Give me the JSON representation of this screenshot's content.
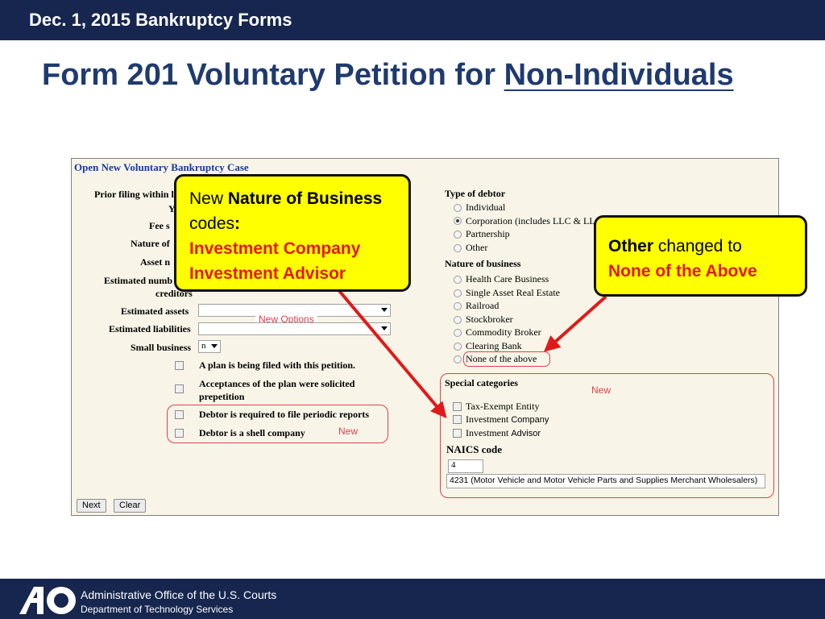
{
  "header": {
    "title": "Dec. 1, 2015 Bankruptcy Forms"
  },
  "slide": {
    "title_main": "Form 201 Voluntary Petition for ",
    "title_underlined": "Non-Individuals"
  },
  "screen": {
    "title": "Open New Voluntary Bankruptcy Case",
    "left": {
      "prior_filing_label": "Prior filing within l",
      "y_label": "Y",
      "fee_label": "Fee s",
      "nature_label": "Nature of",
      "asset_label": "Asset n",
      "estimated_number_label": "Estimated numb",
      "creditors_label": "creditors",
      "estimated_assets_label": "Estimated assets",
      "estimated_liabilities_label": "Estimated liabilities",
      "small_business_label": "Small business",
      "small_business_value": "n",
      "new_options_label": "New Options",
      "checkboxes": [
        "A plan is being filed with this petition.",
        "Acceptances of the plan were solicited",
        "prepetition",
        "Debtor is required to file periodic reports",
        "Debtor is a shell company"
      ],
      "new_label": "New"
    },
    "right": {
      "type_of_debtor_label": "Type of debtor",
      "debtor_types": [
        "Individual",
        "Corporation (includes LLC & LL",
        "Partnership",
        "Other"
      ],
      "nature_of_business_label": "Nature of business",
      "business_types": [
        "Health Care Business",
        "Single Asset Real Estate",
        "Railroad",
        "Stockbroker",
        "Commodity Broker",
        "Clearing Bank",
        "None of the above"
      ],
      "special_categories_label": "Special categories",
      "special_new_label": "New",
      "special_items": [
        "Tax-Exempt Entity",
        "Investment",
        "Investment"
      ],
      "special_items_suffix": [
        "",
        "Company",
        "Advisor"
      ],
      "naics_label": "NAICS code",
      "naics_value": "4",
      "naics_description": "4231 (Motor Vehicle and Motor Vehicle Parts and Supplies Merchant Wholesalers)"
    },
    "buttons": {
      "next": "Next",
      "clear": "Clear"
    }
  },
  "callout_left": {
    "line1_prefix": "New ",
    "line1_bold": "Nature of Business",
    "line2": "codes",
    "line2_colon": ":",
    "line3": "Investment Company",
    "line4": "Investment Advisor"
  },
  "callout_right": {
    "line1_bold": "Other",
    "line1_rest": " changed to",
    "line2": "None of the Above"
  },
  "footer": {
    "logo_text": "AO",
    "line1": "Administrative Office of the U.S. Courts",
    "line2": "Department of Technology Services"
  },
  "colors": {
    "navy": "#16264f",
    "title_blue": "#1f3a6e",
    "callout_yellow": "#ffff00",
    "annotation_red": "#e0404a"
  }
}
